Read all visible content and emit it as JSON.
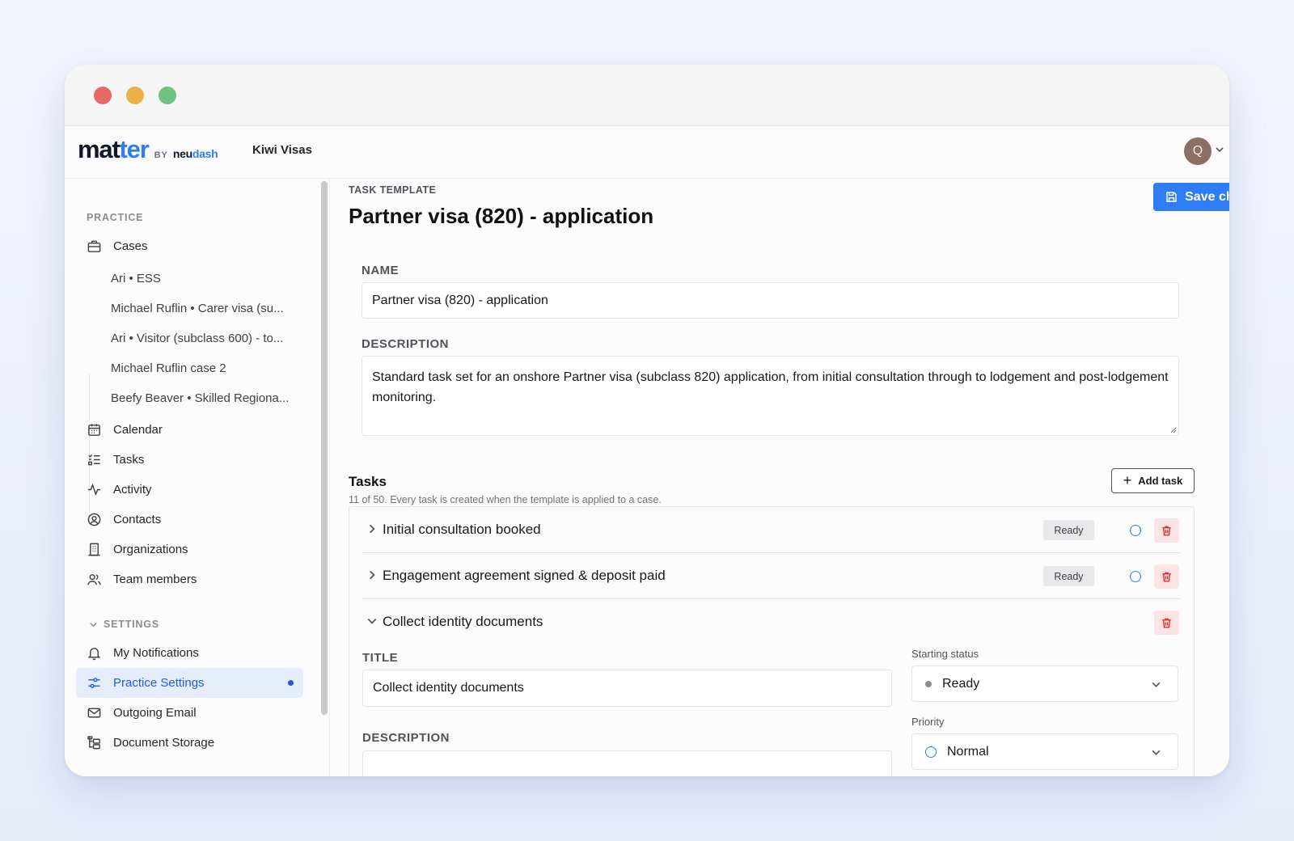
{
  "window": {
    "controls": [
      "close",
      "minimize",
      "maximize"
    ]
  },
  "appbar": {
    "logo": {
      "main_a": "mat",
      "main_b": "ter",
      "by": "BY",
      "brand_a": "neu",
      "brand_b": "dash"
    },
    "org_name": "Kiwi Visas",
    "avatar_initial": "Q"
  },
  "sidebar": {
    "practice_heading": "PRACTICE",
    "cases_label": "Cases",
    "cases": [
      "Ari • ESS",
      "Michael Ruflin • Carer visa (su...",
      "Ari • Visitor (subclass 600) - to...",
      "Michael Ruflin case 2",
      "Beefy Beaver • Skilled Regiona..."
    ],
    "nav": {
      "calendar": "Calendar",
      "tasks": "Tasks",
      "activity": "Activity",
      "contacts": "Contacts",
      "organizations": "Organizations",
      "team_members": "Team members"
    },
    "settings_heading": "SETTINGS",
    "settings": {
      "my_notifications": "My Notifications",
      "practice_settings": "Practice Settings",
      "outgoing_email": "Outgoing Email",
      "document_storage": "Document Storage"
    }
  },
  "main": {
    "eyebrow": "TASK TEMPLATE",
    "title": "Partner visa (820) - application",
    "save_label": "Save changes",
    "name_label": "NAME",
    "name_value": "Partner visa (820) - application",
    "description_label": "DESCRIPTION",
    "description_value": "Standard task set for an onshore Partner visa (subclass 820) application, from initial consultation through to lodgement and post-lodgement monitoring.",
    "tasks_heading": "Tasks",
    "tasks_subtitle": "11 of 50. Every task is created when the template is applied to a case.",
    "add_task_label": "Add task",
    "tasks": [
      {
        "title": "Initial consultation booked",
        "status": "Ready"
      },
      {
        "title": "Engagement agreement signed & deposit paid",
        "status": "Ready"
      },
      {
        "title": "Collect identity documents"
      }
    ],
    "expanded_task": {
      "title_label": "TITLE",
      "title_value": "Collect identity documents",
      "description_label": "DESCRIPTION",
      "starting_status_label": "Starting status",
      "starting_status_value": "Ready",
      "priority_label": "Priority",
      "priority_value": "Normal"
    }
  },
  "colors": {
    "accent": "#2f7df4",
    "danger": "#dc2626",
    "active_bg": "#e5edfb"
  }
}
